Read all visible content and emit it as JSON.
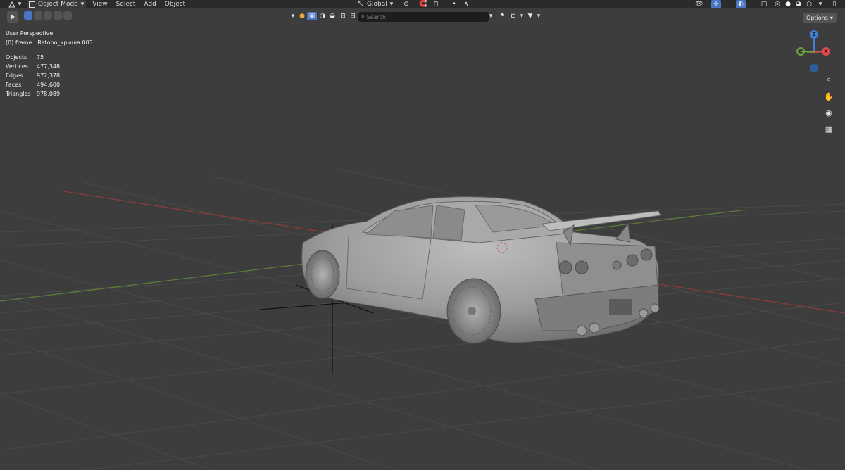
{
  "header": {
    "mode": "Object Mode",
    "menus": [
      "View",
      "Select",
      "Add",
      "Object"
    ],
    "orientation": "Global"
  },
  "toolbar": {
    "search_placeholder": "Search",
    "options_label": "Options"
  },
  "viewport": {
    "view_name": "User Perspective",
    "collection_line": "(0) frame | Retopo_крыша.003",
    "stats": [
      {
        "label": "Objects",
        "value": "75"
      },
      {
        "label": "Vertices",
        "value": "477,348"
      },
      {
        "label": "Edges",
        "value": "972,378"
      },
      {
        "label": "Faces",
        "value": "494,600"
      },
      {
        "label": "Triangles",
        "value": "978,089"
      }
    ]
  },
  "gizmo": {
    "z": "Z",
    "x": "X",
    "y": "Y"
  },
  "colors": {
    "viewport_bg": "#3d3d3d",
    "header_bg": "#2b2b2b",
    "accent": "#4a75c4",
    "axis_x": "#e14a4a",
    "axis_y": "#6ea63e",
    "axis_z": "#3f7fd8"
  }
}
